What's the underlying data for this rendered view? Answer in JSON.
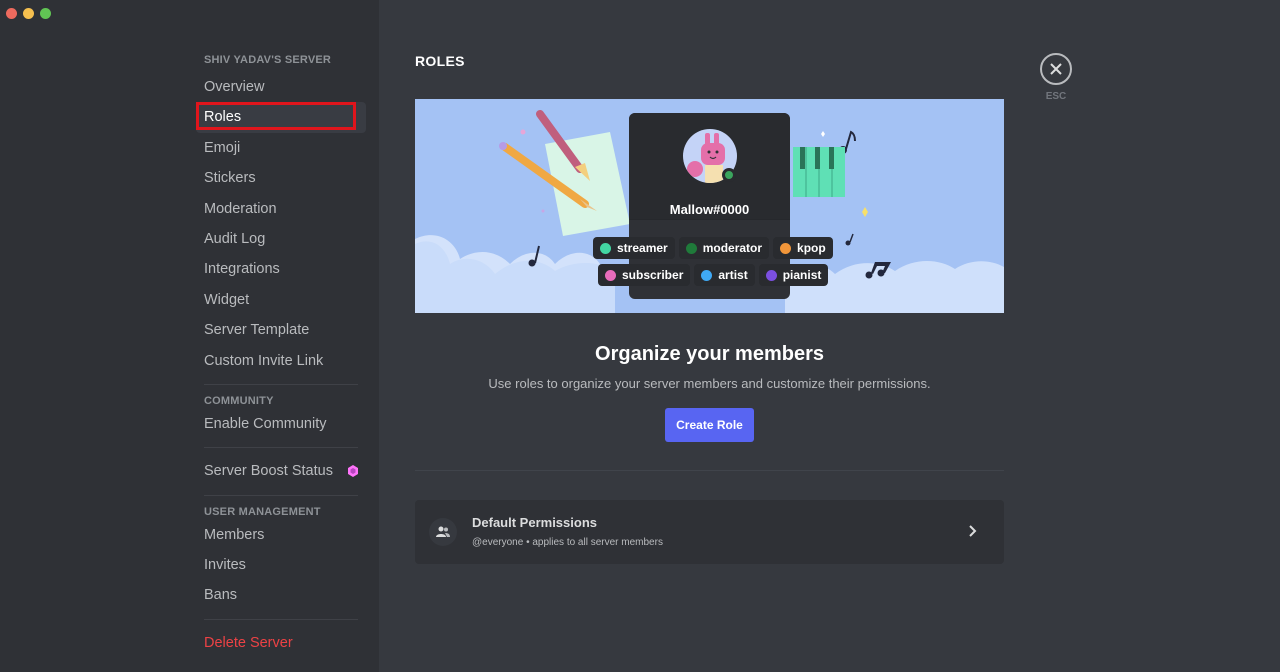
{
  "window": {
    "controls": [
      "close",
      "minimize",
      "maximize"
    ]
  },
  "sidebar": {
    "sections": [
      {
        "header": "SHIV YADAV'S SERVER",
        "items": [
          {
            "label": "Overview"
          },
          {
            "label": "Roles",
            "active": true
          },
          {
            "label": "Emoji"
          },
          {
            "label": "Stickers"
          },
          {
            "label": "Moderation"
          },
          {
            "label": "Audit Log"
          },
          {
            "label": "Integrations"
          },
          {
            "label": "Widget"
          },
          {
            "label": "Server Template"
          },
          {
            "label": "Custom Invite Link"
          }
        ]
      },
      {
        "header": "COMMUNITY",
        "items": [
          {
            "label": "Enable Community"
          }
        ]
      },
      {
        "header": "",
        "items": [
          {
            "label": "Server Boost Status",
            "icon": "boost-gem-icon"
          }
        ]
      },
      {
        "header": "USER MANAGEMENT",
        "items": [
          {
            "label": "Members"
          },
          {
            "label": "Invites"
          },
          {
            "label": "Bans"
          }
        ]
      },
      {
        "header": "",
        "items": [
          {
            "label": "Delete Server",
            "danger": true
          }
        ]
      }
    ]
  },
  "main": {
    "title": "ROLES",
    "banner": {
      "username": "Mallow#0000",
      "roles_row1": [
        {
          "name": "streamer",
          "color": "#43d7a3"
        },
        {
          "name": "moderator",
          "color": "#1f7a3a"
        },
        {
          "name": "kpop",
          "color": "#f1963a"
        }
      ],
      "roles_row2": [
        {
          "name": "subscriber",
          "color": "#e86cbb"
        },
        {
          "name": "artist",
          "color": "#3fa9f5"
        },
        {
          "name": "pianist",
          "color": "#7b4fe0"
        }
      ]
    },
    "hero_title": "Organize your members",
    "hero_subtitle": "Use roles to organize your server members and customize their permissions.",
    "create_role_label": "Create Role",
    "default_permissions": {
      "title": "Default Permissions",
      "subtitle": "@everyone • applies to all server members"
    }
  },
  "close": {
    "label": "ESC"
  },
  "colors": {
    "accent": "#5865f2",
    "danger": "#ed4245",
    "highlight_box": "#e0151c"
  }
}
